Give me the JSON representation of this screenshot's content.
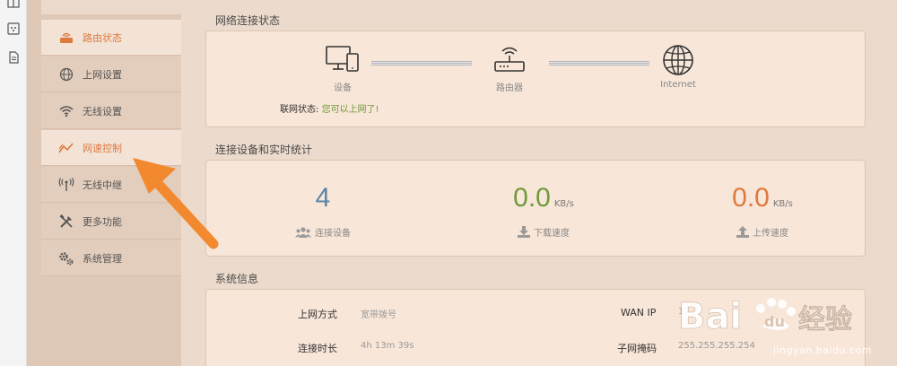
{
  "sidebar": {
    "items": [
      {
        "id": "router-status",
        "label": "路由状态",
        "icon": "router-icon"
      },
      {
        "id": "internet-settings",
        "label": "上网设置",
        "icon": "globe-icon"
      },
      {
        "id": "wireless-settings",
        "label": "无线设置",
        "icon": "wifi-icon"
      },
      {
        "id": "speed-control",
        "label": "网速控制",
        "icon": "speed-chart-icon"
      },
      {
        "id": "wireless-relay",
        "label": "无线中继",
        "icon": "antenna-icon"
      },
      {
        "id": "more-features",
        "label": "更多功能",
        "icon": "tools-icon"
      },
      {
        "id": "system-management",
        "label": "系统管理",
        "icon": "gears-icon"
      }
    ]
  },
  "network_status": {
    "title": "网络连接状态",
    "nodes": {
      "device": "设备",
      "router": "路由器",
      "internet": "Internet"
    },
    "state_label": "联网状态:",
    "state_value": "您可以上网了!"
  },
  "stats": {
    "title": "连接设备和实时统计",
    "devices": {
      "value": "4",
      "caption": "连接设备"
    },
    "download": {
      "value": "0.0",
      "unit": "KB/s",
      "caption": "下载速度"
    },
    "upload": {
      "value": "0.0",
      "unit": "KB/s",
      "caption": "上传速度"
    }
  },
  "system_info": {
    "title": "系统信息",
    "rows": [
      {
        "label": "上网方式",
        "value": "宽带拨号"
      },
      {
        "label": "WAN IP",
        "value": "17"
      },
      {
        "label": "连接时长",
        "value": "4h 13m 39s"
      },
      {
        "label": "子网掩码",
        "value": "255.255.255.254"
      }
    ]
  },
  "watermark": {
    "text": "Baidu经验",
    "url": "jingyan.baidu.com"
  },
  "colors": {
    "accent": "#dd7a3e",
    "green": "#6f9a3c",
    "blue": "#5b84a8"
  }
}
